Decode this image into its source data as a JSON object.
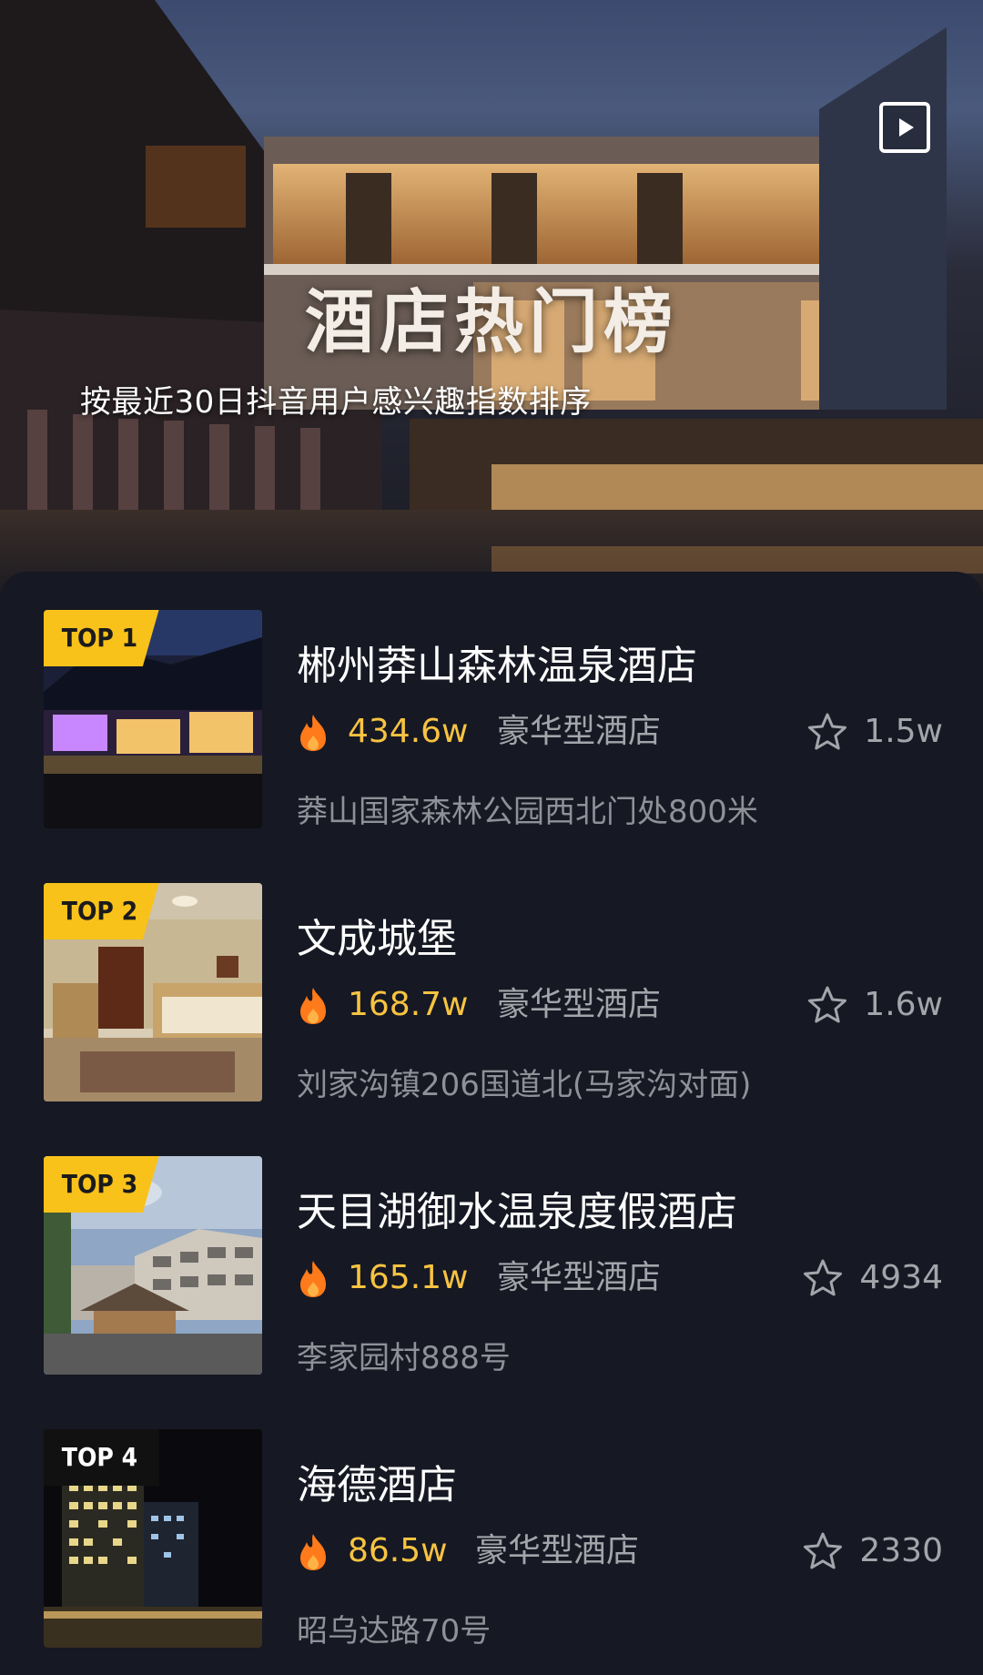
{
  "header": {
    "title": "酒店热门榜",
    "subtitle": "按最近30日抖音用户感兴趣指数排序",
    "play_icon": "play-icon"
  },
  "hotels": [
    {
      "rank": "TOP 1",
      "name": "郴州莽山森林温泉酒店",
      "heat": "434.6w",
      "type": "豪华型酒店",
      "favorites": "1.5w",
      "address": "莽山国家森林公园西北门处800米"
    },
    {
      "rank": "TOP 2",
      "name": "文成城堡",
      "heat": "168.7w",
      "type": "豪华型酒店",
      "favorites": "1.6w",
      "address": "刘家沟镇206国道北(马家沟对面)"
    },
    {
      "rank": "TOP 3",
      "name": "天目湖御水温泉度假酒店",
      "heat": "165.1w",
      "type": "豪华型酒店",
      "favorites": "4934",
      "address": "李家园村888号"
    },
    {
      "rank": "TOP 4",
      "name": "海德酒店",
      "heat": "86.5w",
      "type": "豪华型酒店",
      "favorites": "2330",
      "address": "昭乌达路70号"
    }
  ],
  "icons": {
    "heat": "flame-icon",
    "favorite": "star-outline-icon"
  },
  "colors": {
    "background": "#161823",
    "badge": "#f9c21a",
    "heat_text": "#f7c341",
    "flame": "#ff7a1a",
    "secondary_text": "#a4a5ab"
  }
}
